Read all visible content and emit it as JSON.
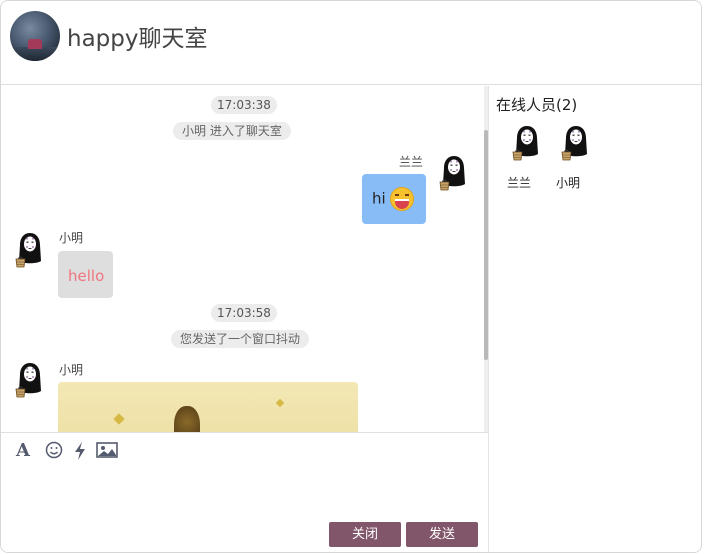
{
  "header": {
    "title": "happy聊天室",
    "avatar_icon": "room-avatar-photo"
  },
  "chat": {
    "messages": [
      {
        "type": "time",
        "text": "17:03:38"
      },
      {
        "type": "system",
        "text": "小明 进入了聊天室"
      },
      {
        "type": "mine",
        "name": "兰兰",
        "text": "hi",
        "emoji": "grinning-face-emoji"
      },
      {
        "type": "theirs",
        "name": "小明",
        "text": "hello"
      },
      {
        "type": "time",
        "text": "17:03:58"
      },
      {
        "type": "system",
        "text": "您发送了一个窗口抖动"
      },
      {
        "type": "theirs-image",
        "name": "小明"
      }
    ]
  },
  "toolbar": {
    "font_icon": "font-icon",
    "emoji_icon": "emoji-icon",
    "shake_icon": "lightning-icon",
    "image_icon": "image-icon"
  },
  "buttons": {
    "close": "关闭",
    "send": "发送"
  },
  "online": {
    "title": "在线人员(2)",
    "members": [
      {
        "name": "兰兰"
      },
      {
        "name": "小明"
      }
    ]
  },
  "colors": {
    "accent_button": "#82566a",
    "my_bubble": "#87bcf7",
    "their_bubble": "#dedede",
    "their_text": "#f0757e"
  }
}
